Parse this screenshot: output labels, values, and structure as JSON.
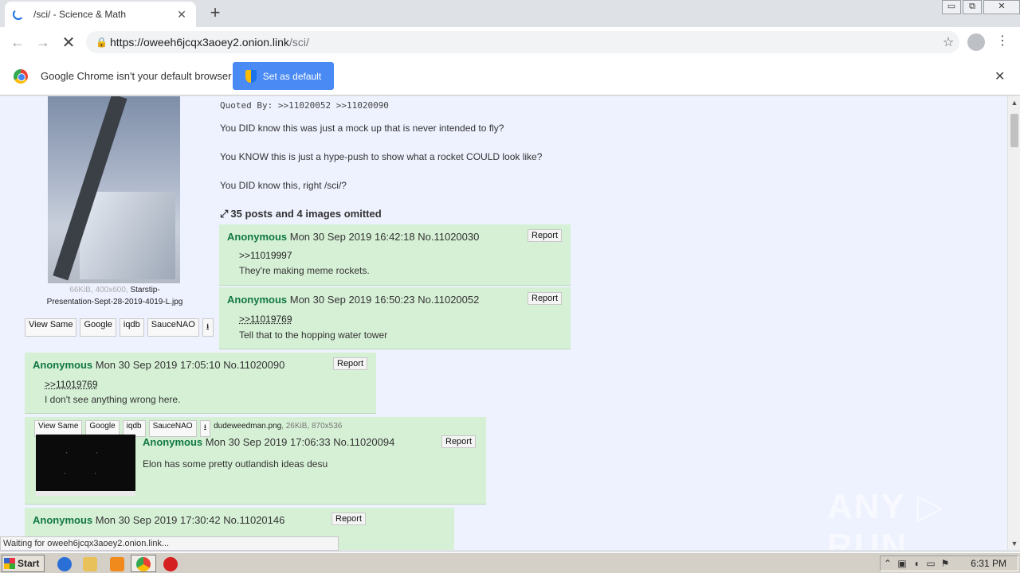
{
  "browser": {
    "tab_title": "/sci/ - Science & Math",
    "url_host": "https://oweeh6jcqx3aoey2.onion.link",
    "url_path": "/sci/",
    "window_controls": [
      "▭",
      "⧉",
      "✕"
    ]
  },
  "infobar": {
    "message": "Google Chrome isn't your default browser",
    "button": "Set as default"
  },
  "op": {
    "file_meta": "66KiB, 400x600,",
    "file_name": "Starstip-Presentation-Sept-28-2019-4019-L.jpg",
    "quoted_by_label": "Quoted By:",
    "quoted_by": ">>11020052 >>11020090",
    "tools": [
      "View Same",
      "Google",
      "iqdb",
      "SauceNAO"
    ],
    "lines": [
      "You DID know this was just a mock up that is never intended to fly?",
      "You KNOW this is just a hype-push to show what a rocket COULD look like?",
      "You DID know this, right /sci/?"
    ],
    "omitted": "35 posts and 4 images omitted"
  },
  "replies": [
    {
      "name": "Anonymous",
      "date": "Mon 30 Sep 2019 16:42:18",
      "no": "No.11020030",
      "report": "Report",
      "quote": ">>11019997",
      "text": "They're making meme rockets."
    },
    {
      "name": "Anonymous",
      "date": "Mon 30 Sep 2019 16:50:23",
      "no": "No.11020052",
      "report": "Report",
      "quote": ">>11019769",
      "text": "Tell that to the hopping water tower"
    },
    {
      "name": "Anonymous",
      "date": "Mon 30 Sep 2019 17:05:10",
      "no": "No.11020090",
      "report": "Report",
      "quote": ">>11019769",
      "text": "I don't see anything wrong here."
    },
    {
      "name": "Anonymous",
      "date": "Mon 30 Sep 2019 17:06:33",
      "no": "No.11020094",
      "report": "Report",
      "text": "Elon has some pretty outlandish ideas desu",
      "file_tools": [
        "View Same",
        "Google",
        "iqdb",
        "SauceNAO"
      ],
      "file_name": "dudeweedman.png",
      "file_meta": ", 26KiB, 870x536"
    },
    {
      "name": "Anonymous",
      "date": "Mon 30 Sep 2019 17:30:42",
      "no": "No.11020146",
      "report": "Report"
    }
  ],
  "status": "Waiting for oweeh6jcqx3aoey2.onion.link...",
  "watermark": "ANY ▷ RUN",
  "taskbar": {
    "start": "Start",
    "clock": "6:31 PM"
  }
}
